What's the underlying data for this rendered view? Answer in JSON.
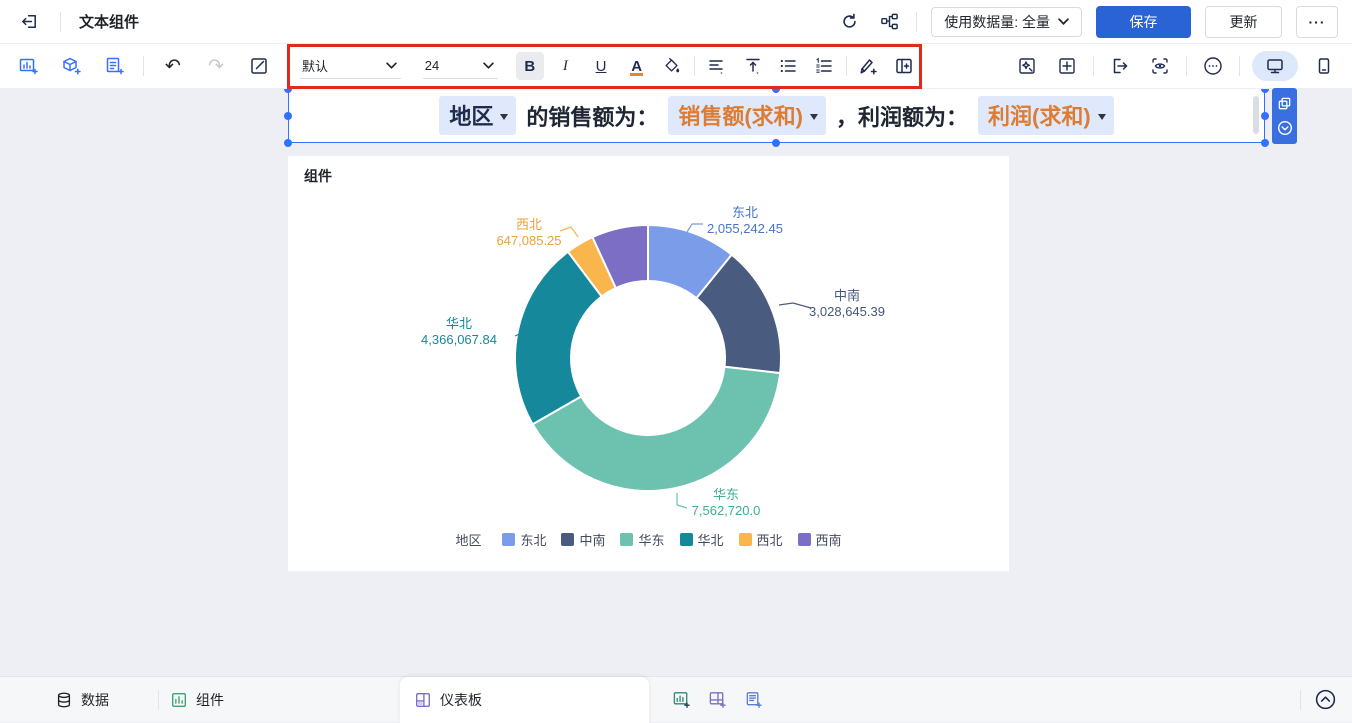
{
  "header": {
    "title": "文本组件",
    "data_volume_label": "使用数据量: 全量",
    "save_label": "保存",
    "update_label": "更新",
    "more_label": "···"
  },
  "toolbar": {
    "font_family": "默认",
    "font_size": "24",
    "bold_label": "B",
    "italic_label": "I",
    "underline_label": "U",
    "font_color_label": "A"
  },
  "text_component": {
    "dimension_chip": "地区",
    "text_after_dimension": "的销售额为：",
    "measure1_chip": "销售额(求和)",
    "text_between": "，利润额为：",
    "measure2_chip": "利润(求和)"
  },
  "chart_card": {
    "title": "组件"
  },
  "chart_data": {
    "type": "pie",
    "subtype": "donut",
    "title": "组件",
    "legend_title": "地区",
    "legend_position": "bottom",
    "series": [
      {
        "name": "东北",
        "value": 2055242.45,
        "label": "2,055,242.45",
        "color": "#7B9CE8",
        "label_color": "#4873CE"
      },
      {
        "name": "中南",
        "value": 3028645.39,
        "label": "3,028,645.39",
        "color": "#4A5B80",
        "label_color": "#45577E"
      },
      {
        "name": "华东",
        "value": 7562720.0,
        "label": "7,562,720.0",
        "color": "#6CC2AE",
        "label_color": "#3EAE94"
      },
      {
        "name": "华北",
        "value": 4366067.84,
        "label": "4,366,067.84",
        "color": "#15899B",
        "label_color": "#16889A"
      },
      {
        "name": "西北",
        "value": 647085.25,
        "label": "647,085.25",
        "color": "#F8B64C",
        "label_color": "#E8A23B"
      },
      {
        "name": "西南",
        "value": 1300000,
        "label": "",
        "color": "#7C6EC4",
        "label_color": "#7C6EC4",
        "value_estimated_from_pixels": true
      }
    ]
  },
  "bottom_bar": {
    "data_label": "数据",
    "component_label": "组件",
    "dashboard_tab_label": "仪表板"
  }
}
